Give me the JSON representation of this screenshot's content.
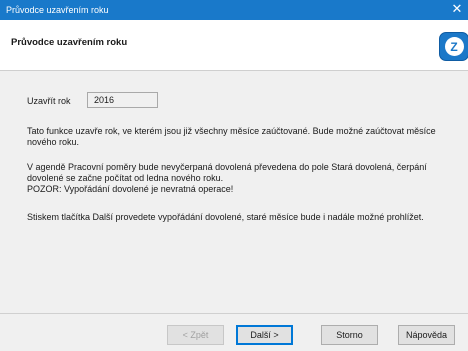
{
  "window": {
    "title": "Průvodce uzavřením roku",
    "close_glyph": "✕"
  },
  "header": {
    "title": "Průvodce uzavřením roku",
    "logo_icon": "app-logo-icon",
    "logo_glyph": "Z"
  },
  "form": {
    "year_label": "Uzavřít rok",
    "year_value": "2016"
  },
  "text": {
    "p1": "Tato funkce uzavře rok, ve kterém jsou již všechny měsíce zaúčtované. Bude možné zaúčtovat měsíce nového roku.",
    "p2_line1": "V agendě Pracovní poměry bude nevyčerpaná dovolená převedena do pole Stará dovolená, čerpání dovolené se začne počítat od ledna nového roku.",
    "p2_line2": "POZOR: Vypořádání dovolené je nevratná operace!",
    "p3": "Stiskem tlačítka Další provedete vypořádání dovolené, staré měsíce bude i nadále možné prohlížet."
  },
  "buttons": {
    "back": "< Zpět",
    "next": "Další >",
    "cancel": "Storno",
    "help": "Nápověda"
  },
  "colors": {
    "titlebar": "#1979ca",
    "logo": "#1b78c8"
  }
}
